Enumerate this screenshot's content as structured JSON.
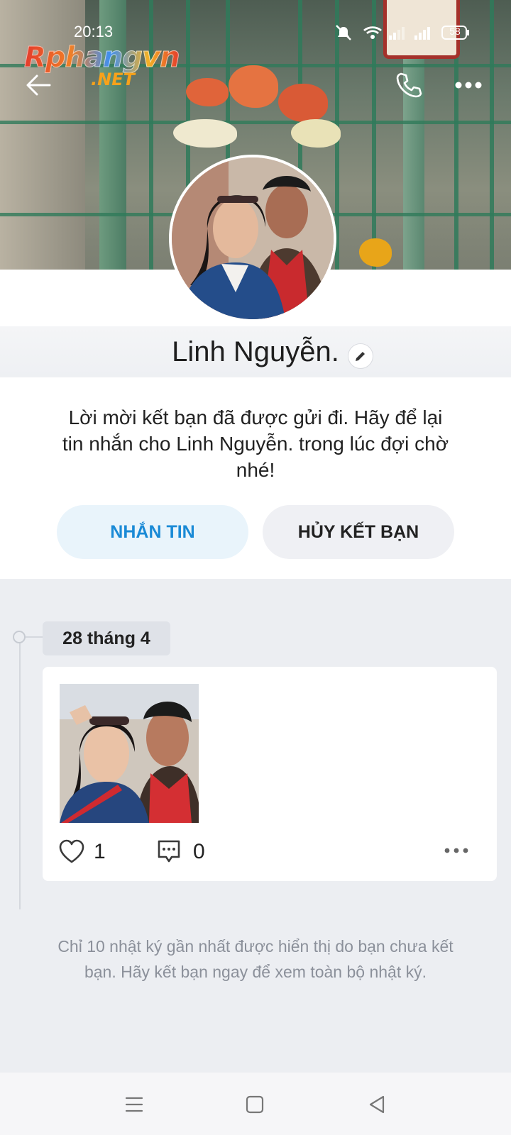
{
  "status_bar": {
    "time": "20:13",
    "battery": "58"
  },
  "watermark": {
    "brand": "Rphangvn",
    "suffix": ".NET"
  },
  "profile": {
    "name": "Linh Nguyễn.",
    "message": "Lời mời kết bạn đã được gửi đi. Hãy để lại tin nhắn cho Linh Nguyễn. trong lúc đợi chờ nhé!"
  },
  "actions": {
    "message_label": "NHẮN TIN",
    "cancel_label": "HỦY KẾT BẠN"
  },
  "timeline": {
    "date": "28 tháng 4",
    "post": {
      "likes": "1",
      "comments": "0"
    },
    "footer_note": "Chỉ 10 nhật ký gần nhất được hiển thị do bạn chưa kết bạn. Hãy kết bạn ngay để xem toàn bộ nhật ký."
  },
  "colors": {
    "accent": "#1a8ad6",
    "page_bg": "#eceef2"
  }
}
